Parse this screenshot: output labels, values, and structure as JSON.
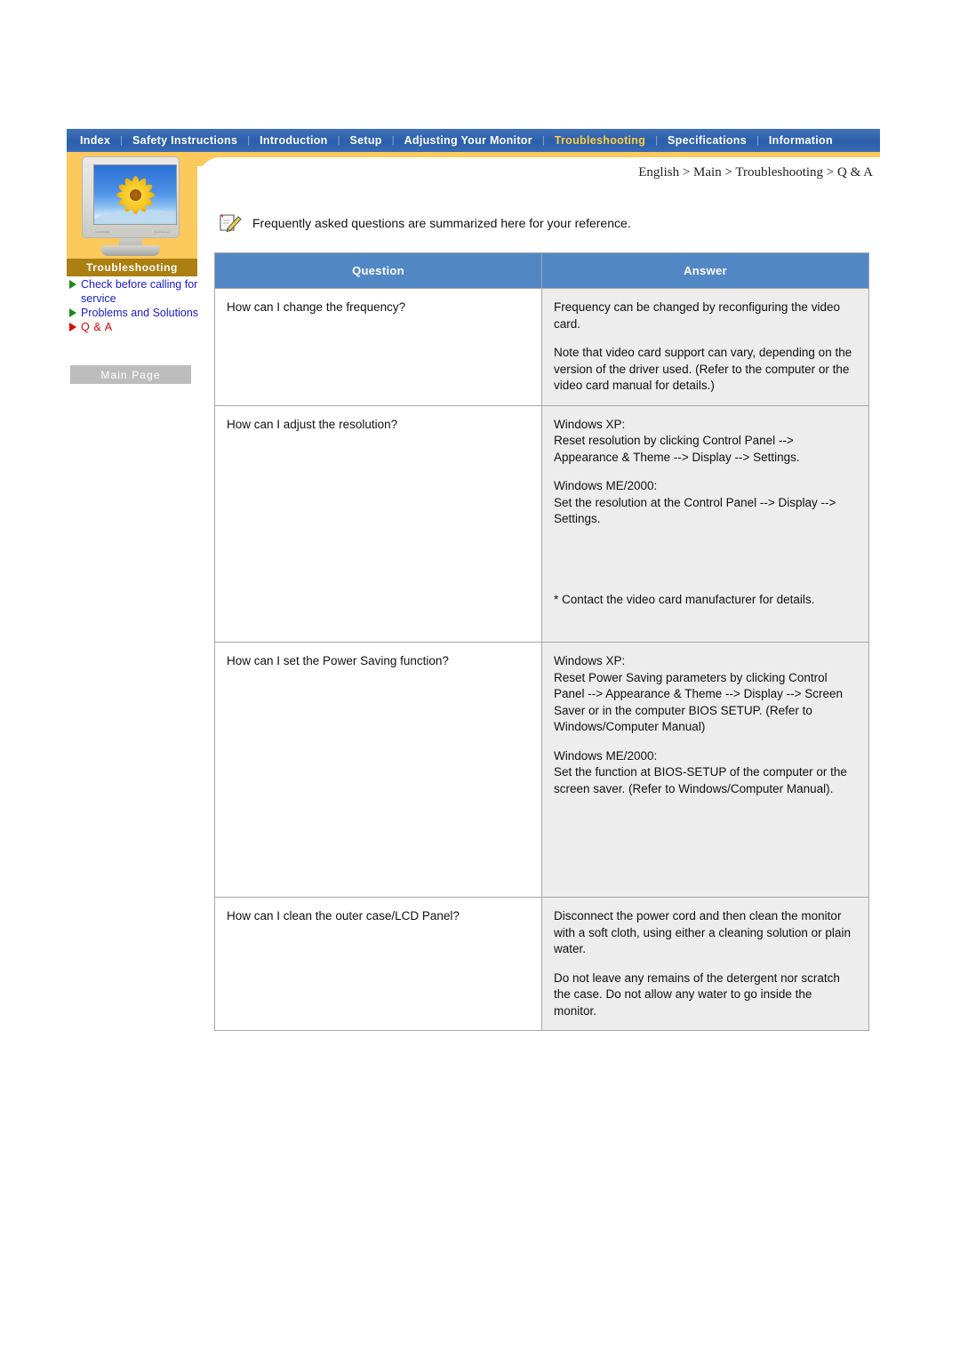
{
  "nav": {
    "items": [
      {
        "label": "Index",
        "active": false
      },
      {
        "label": "Safety Instructions",
        "active": false
      },
      {
        "label": "Introduction",
        "active": false
      },
      {
        "label": "Setup",
        "active": false
      },
      {
        "label": "Adjusting Your Monitor",
        "active": false
      },
      {
        "label": "Troubleshooting",
        "active": true
      },
      {
        "label": "Specifications",
        "active": false
      },
      {
        "label": "Information",
        "active": false
      }
    ],
    "separator": "|",
    "active_color": "#ffcf3d",
    "bar_color": "#2e61ae"
  },
  "sidebar": {
    "section_title": "Troubleshooting",
    "section_title_bg": "#ab7f12",
    "panel_color": "#fcc95c",
    "items": [
      {
        "label": "Check before calling for service",
        "active": false,
        "marker_color": "#1a8a1a"
      },
      {
        "label": "Problems and Solutions",
        "active": false,
        "marker_color": "#1a8a1a"
      },
      {
        "label": "Q & A",
        "active": true,
        "marker_color": "#e00000"
      }
    ],
    "main_page_button": "Main Page",
    "thumbnail": {
      "icon": "lcd-monitor-sunflower-image",
      "brand_left": "SAMSUNG",
      "brand_right": "SyncMaster"
    }
  },
  "breadcrumb": "English > Main > Troubleshooting > Q & A",
  "intro": {
    "icon": "notepad-pencil-icon",
    "text": "Frequently asked questions are summarized here for your reference."
  },
  "table": {
    "headers": [
      "Question",
      "Answer"
    ],
    "header_bg": "#5287c6",
    "answer_bg": "#ededed",
    "rows": [
      {
        "question": "How can I change the frequency?",
        "answer_paragraphs": [
          "Frequency can be changed by reconfiguring the video card.",
          "Note that video card support can vary, depending on the version of the driver used. (Refer to the computer or the video card manual for details.)"
        ]
      },
      {
        "question": "How can I adjust the resolution?",
        "answer_paragraphs": [
          "Windows XP:\nReset resolution by clicking Control Panel --> Appearance & Theme --> Display --> Settings.",
          "Windows ME/2000:\nSet the resolution at the Control Panel --> Display --> Settings.",
          "* Contact the video card manufacturer for details."
        ]
      },
      {
        "question": "How can I set the Power Saving function?",
        "answer_paragraphs": [
          "Windows XP:\nReset Power Saving parameters by clicking Control Panel --> Appearance & Theme --> Display --> Screen Saver or in the computer BIOS SETUP. (Refer to Windows/Computer Manual)",
          "Windows ME/2000:\nSet the function at BIOS-SETUP of the computer or the screen saver. (Refer to Windows/Computer Manual)."
        ]
      },
      {
        "question": "How can I clean the outer case/LCD Panel?",
        "answer_paragraphs": [
          "Disconnect the power cord and then clean the monitor with a soft cloth, using either a cleaning solution or plain water.",
          "Do not leave any remains of the detergent nor scratch the case. Do not allow any water to go inside the monitor."
        ]
      }
    ]
  }
}
